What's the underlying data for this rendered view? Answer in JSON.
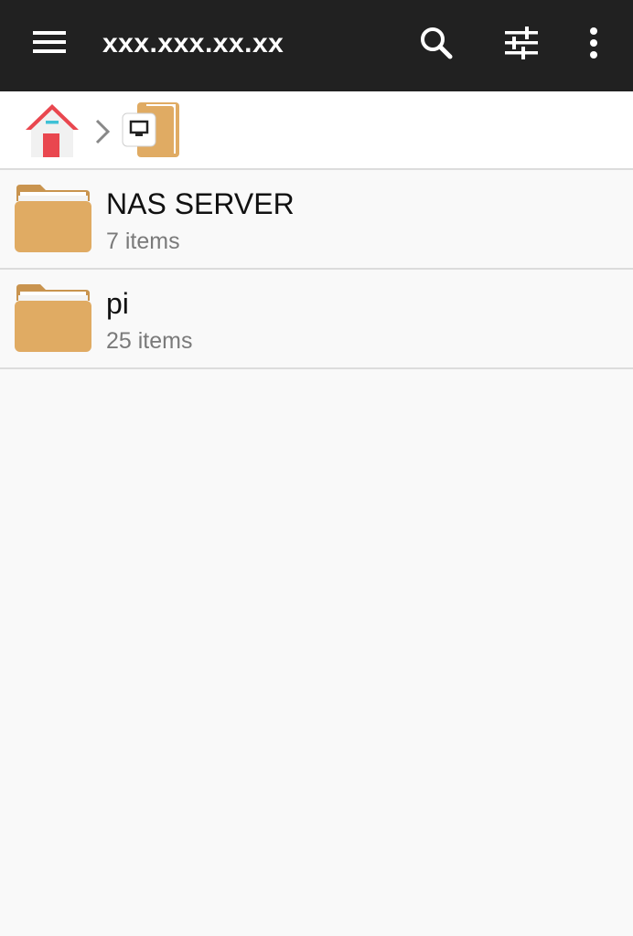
{
  "app_bar": {
    "menu_icon": "hamburger-menu-icon",
    "title": "xxx.xxx.xx.xx",
    "actions": [
      {
        "name": "search",
        "icon": "search-icon"
      },
      {
        "name": "filter",
        "icon": "sliders-icon"
      },
      {
        "name": "more",
        "icon": "more-vertical-icon"
      }
    ],
    "background_color": "#212121"
  },
  "breadcrumb": [
    {
      "icon": "home-icon"
    },
    {
      "icon": "network-device-folder-icon"
    }
  ],
  "folders": [
    {
      "name": "NAS SERVER",
      "count": "7 items",
      "icon": "folder-icon"
    },
    {
      "name": "pi",
      "count": "25 items",
      "icon": "folder-icon"
    }
  ],
  "colors": {
    "folder": "#e0ab63",
    "home_roof": "#e9474f",
    "home_door": "#e9474f"
  }
}
